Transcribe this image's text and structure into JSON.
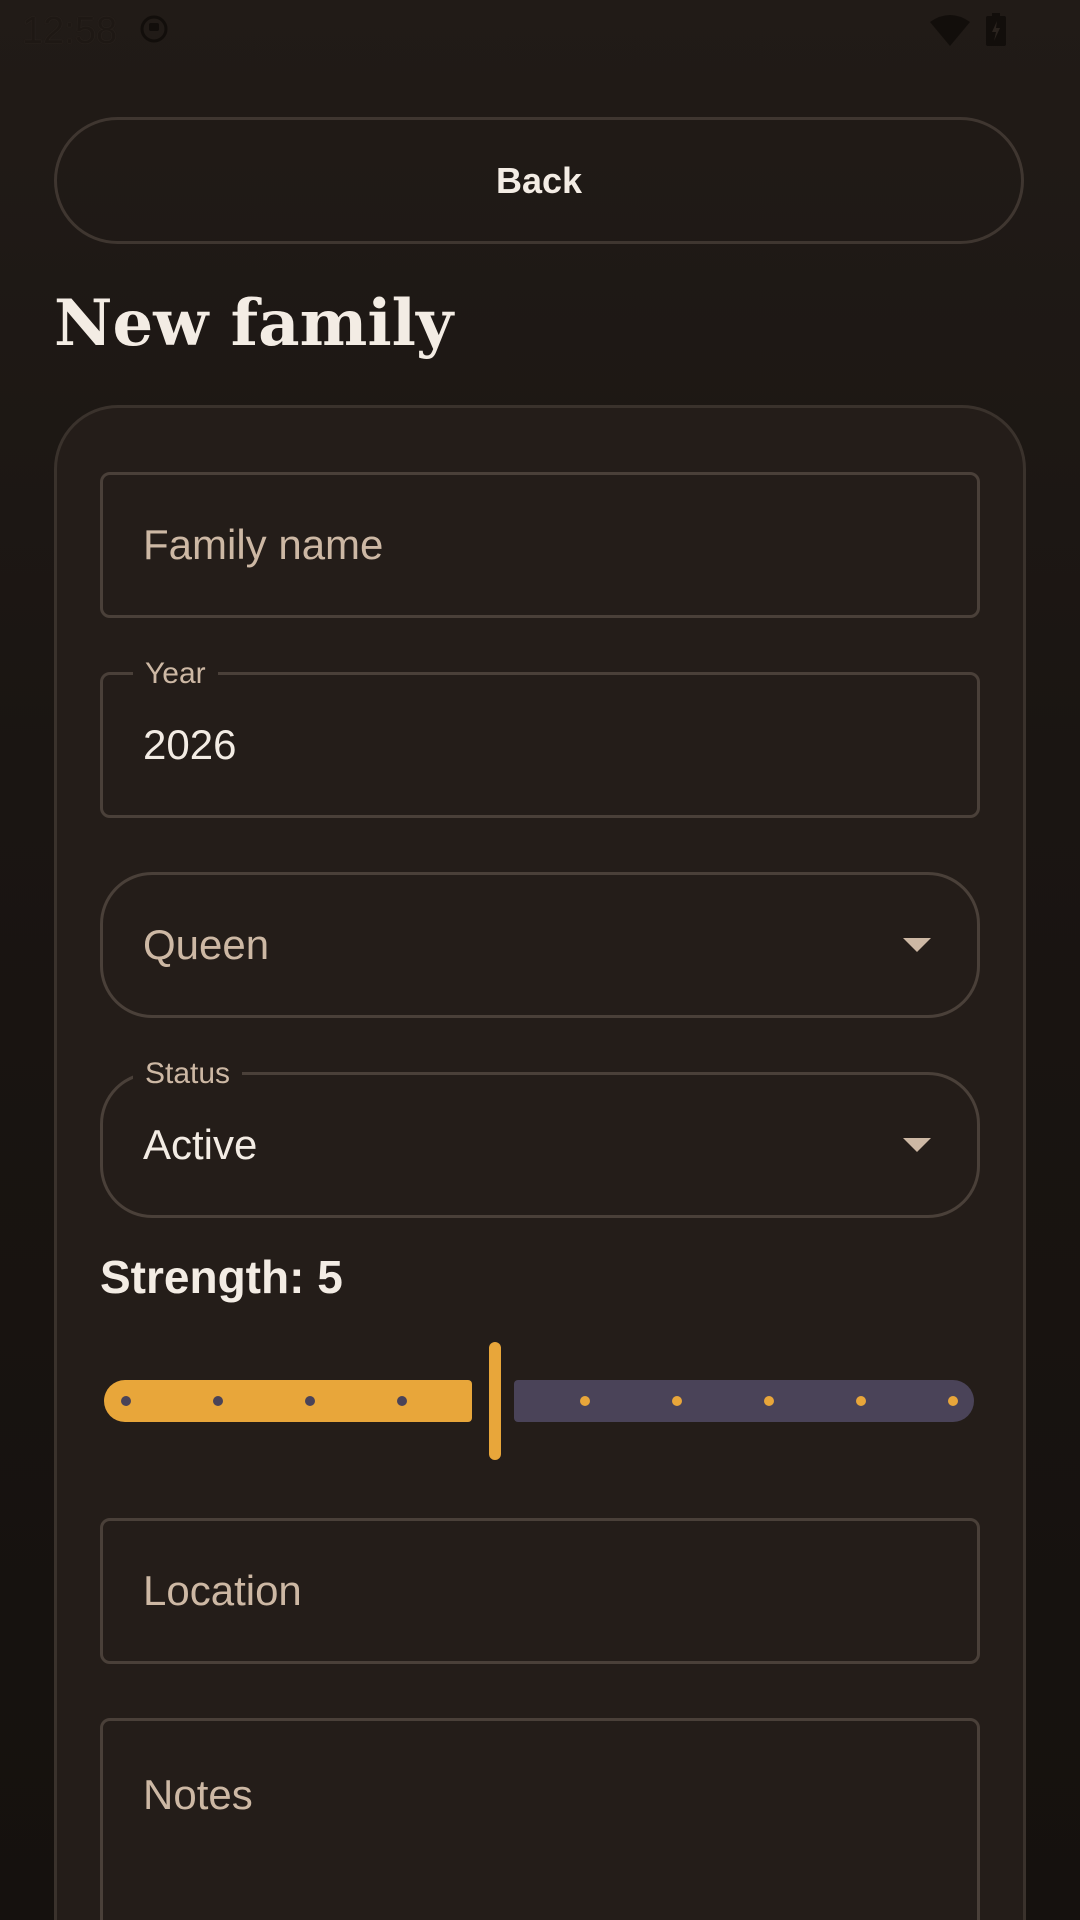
{
  "status_bar": {
    "time": "12:58"
  },
  "toolbar": {
    "back_label": "Back"
  },
  "page": {
    "title": "New family"
  },
  "form": {
    "family_name": {
      "placeholder": "Family name",
      "value": ""
    },
    "year": {
      "label": "Year",
      "value": "2026"
    },
    "queen": {
      "placeholder": "Queen",
      "value": ""
    },
    "status": {
      "label": "Status",
      "value": "Active"
    },
    "strength": {
      "label": "Strength: 5",
      "value": 5,
      "min": 1,
      "max": 10
    },
    "location": {
      "placeholder": "Location",
      "value": ""
    },
    "notes": {
      "placeholder": "Notes",
      "value": ""
    }
  },
  "colors": {
    "accent": "#e8a63a",
    "track_inactive": "#4a4358",
    "background": "#1a1512",
    "card": "#241d19"
  }
}
